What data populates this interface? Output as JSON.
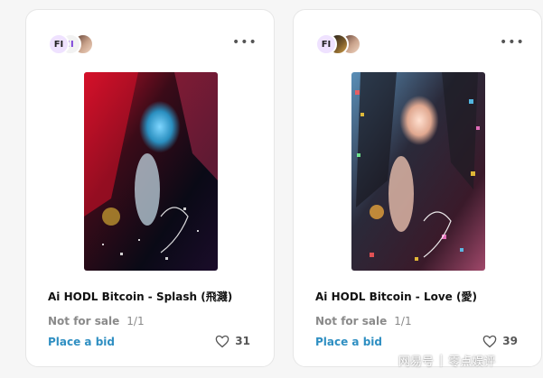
{
  "cards": [
    {
      "title": "Ai HODL Bitcoin - Splash (飛濺)",
      "status": "Not for sale",
      "edition": "1/1",
      "action": "Place a bid",
      "likes": "31",
      "avatars": [
        "FI-logo",
        "II-logo",
        "owner-photo"
      ],
      "menu_icon": "more-horizontal-icon"
    },
    {
      "title": "Ai HODL Bitcoin - Love (愛)",
      "status": "Not for sale",
      "edition": "1/1",
      "action": "Place a bid",
      "likes": "39",
      "avatars": [
        "FI-logo",
        "tiger-photo",
        "owner-photo"
      ],
      "menu_icon": "more-horizontal-icon"
    }
  ],
  "watermark": {
    "left": "网易号",
    "right": "零点娱评"
  },
  "colors": {
    "accent_link": "#2f8fc2",
    "muted_text": "#8a8a8a",
    "title_text": "#111111"
  }
}
